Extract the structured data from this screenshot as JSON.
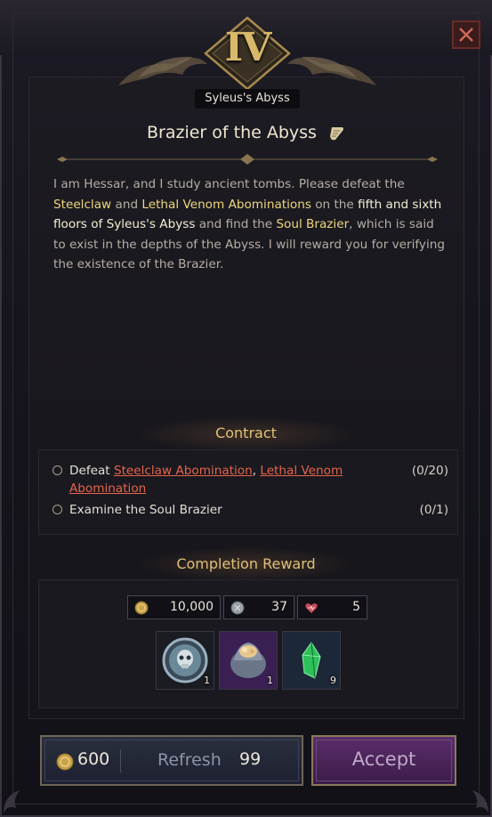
{
  "header": {
    "rank": "IV",
    "region": "Syleus's Abyss",
    "close_icon": "close-icon"
  },
  "quest": {
    "title": "Brazier of the Abyss",
    "title_icon": "scroll-icon",
    "description": {
      "p1": "I am Hessar, and I study ancient tombs. Please defeat the ",
      "h1": "Steelclaw",
      "p2": " and ",
      "h2": "Lethal Venom Abominations",
      "p3": " on the ",
      "h3": "fifth and sixth floors of Syleus's Abyss",
      "p4": " and find the ",
      "h4": "Soul Brazier",
      "p5": ", which is said to exist in the depths of the Abyss. I will reward you for verifying the existence of the Brazier."
    }
  },
  "contract": {
    "title": "Contract",
    "objectives": [
      {
        "prefix": "Defeat ",
        "link1": "Steelclaw Abomination",
        "sep": ", ",
        "link2": "Lethal Venom Abomination",
        "count": "(0/20)"
      },
      {
        "text": "Examine the Soul Brazier",
        "count": "(0/1)"
      }
    ]
  },
  "reward": {
    "title": "Completion Reward",
    "currencies": [
      {
        "icon": "gold-coin-icon",
        "value": "10,000"
      },
      {
        "icon": "silver-coin-icon",
        "value": "37"
      },
      {
        "icon": "heart-icon",
        "value": "5"
      }
    ],
    "items": [
      {
        "icon": "skull-medallion-icon",
        "qty": "1"
      },
      {
        "icon": "ore-chest-icon",
        "qty": "1"
      },
      {
        "icon": "green-crystal-icon",
        "qty": "9"
      }
    ]
  },
  "actions": {
    "refresh_cost": "600",
    "refresh_label": "Refresh",
    "refresh_count": "99",
    "accept_label": "Accept"
  },
  "colors": {
    "accent_gold": "#e0c078",
    "highlight_yellow": "#eed77c",
    "link_red": "#e8644a",
    "accept_purple": "#5a2d6a"
  }
}
